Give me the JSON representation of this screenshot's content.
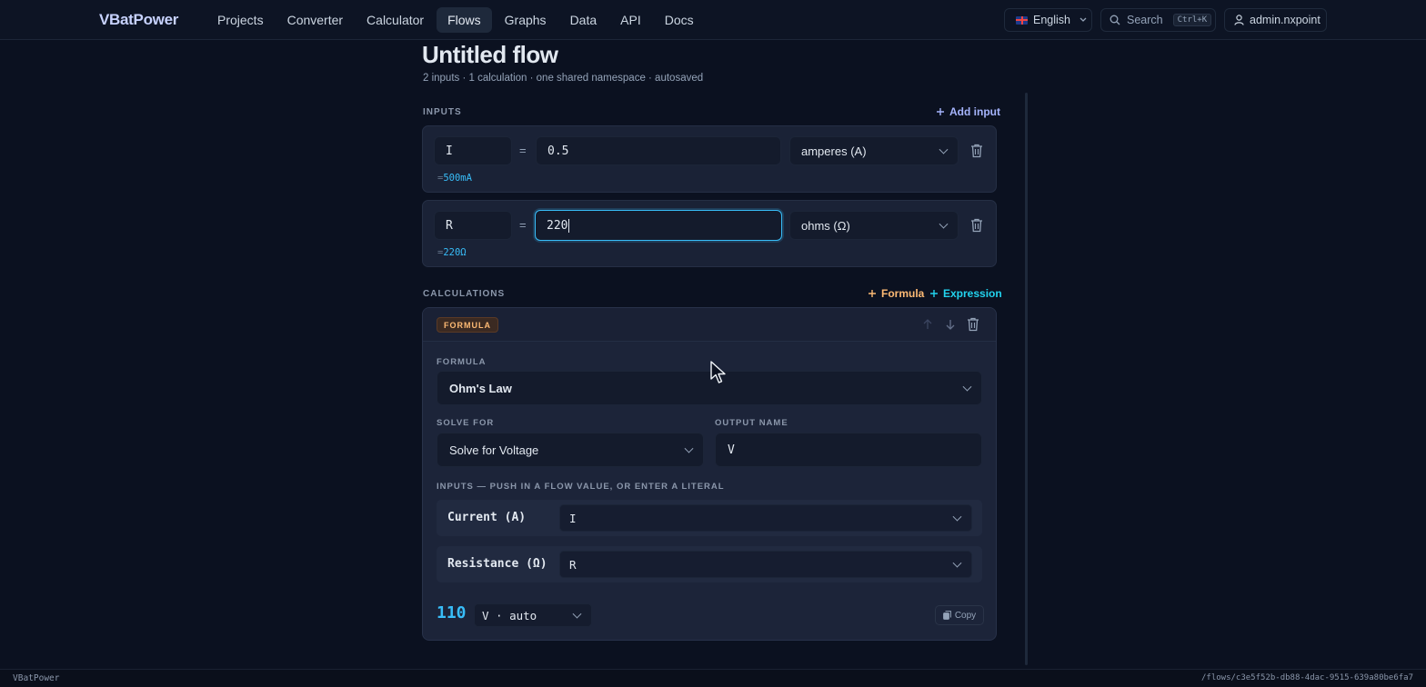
{
  "app": {
    "brand": "VBatPower"
  },
  "nav": {
    "items": [
      {
        "label": "Projects",
        "active": false
      },
      {
        "label": "Converter",
        "active": false
      },
      {
        "label": "Calculator",
        "active": false
      },
      {
        "label": "Flows",
        "active": true
      },
      {
        "label": "Graphs",
        "active": false
      },
      {
        "label": "Data",
        "active": false
      },
      {
        "label": "API",
        "active": false
      },
      {
        "label": "Docs",
        "active": false
      }
    ],
    "language": "English",
    "search_label": "Search",
    "search_shortcut": "Ctrl+K",
    "user": "admin.nxpoint"
  },
  "page": {
    "title": "Untitled flow",
    "subtitle": "2 inputs · 1 calculation · one shared namespace · autosaved"
  },
  "inputs_section": {
    "label": "INPUTS",
    "add_label": "Add input",
    "items": [
      {
        "name": "I",
        "equals": "=",
        "value": "0.5",
        "unit": "amperes (A)",
        "converted_prefix": "=",
        "converted": "500mA"
      },
      {
        "name": "R",
        "equals": "=",
        "value": "220",
        "unit": "ohms (Ω)",
        "converted_prefix": "=",
        "converted": "220Ω"
      }
    ]
  },
  "calc_section": {
    "label": "CALCULATIONS",
    "add_formula": "Formula",
    "add_expression": "Expression",
    "card": {
      "badge": "FORMULA",
      "formula_label": "FORMULA",
      "formula_value": "Ohm's Law",
      "solve_for_label": "SOLVE FOR",
      "solve_for_value": "Solve for Voltage",
      "output_name_label": "OUTPUT NAME",
      "output_name_value": "V",
      "inputs_label": "INPUTS — PUSH IN A FLOW VALUE, OR ENTER A LITERAL",
      "inputs": [
        {
          "label": "Current (A)",
          "value": "I"
        },
        {
          "label": "Resistance (Ω)",
          "value": "R"
        }
      ],
      "result_value": "110",
      "result_unit": "V · auto",
      "copy_label": "Copy"
    }
  },
  "footer": {
    "left": "VBatPower",
    "right": "/flows/c3e5f52b-db88-4dac-9515-639a80be6fa7"
  },
  "colors": {
    "accent": "#38bdf8",
    "brand": "#c7d2fe",
    "formula": "#fdba74",
    "expression": "#22d3ee"
  }
}
